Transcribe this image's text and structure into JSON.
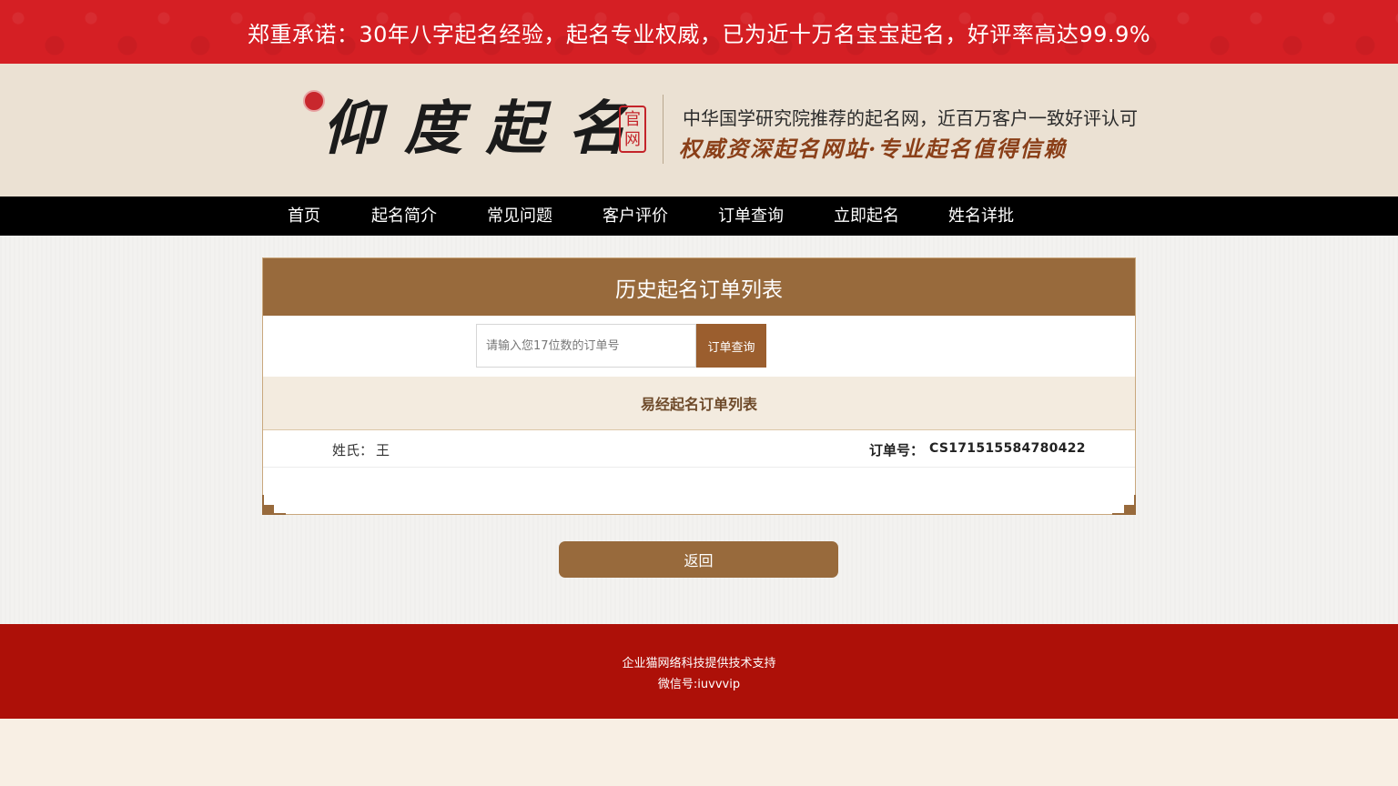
{
  "banner": {
    "text": "郑重承诺：30年八字起名经验，起名专业权威，已为近十万名宝宝起名，好评率高达99.9%"
  },
  "header": {
    "logo_text": "仰度起名",
    "official_stamp": "官网",
    "slogan_line1": "中华国学研究院推荐的起名网，近百万客户一致好评认可",
    "slogan_line2": "权威资深起名网站·专业起名值得信赖"
  },
  "nav": {
    "items": [
      {
        "label": "首页"
      },
      {
        "label": "起名简介"
      },
      {
        "label": "常见问题"
      },
      {
        "label": "客户评价"
      },
      {
        "label": "订单查询"
      },
      {
        "label": "立即起名"
      },
      {
        "label": "姓名详批"
      }
    ]
  },
  "panel": {
    "title": "历史起名订单列表",
    "search_placeholder": "请输入您17位数的订单号",
    "search_value": "",
    "search_button": "订单查询",
    "list_title": "易经起名订单列表",
    "orders": [
      {
        "surname_label": "姓氏：",
        "surname": "王",
        "order_label": "订单号：",
        "order_no": "CS171515584780422"
      }
    ]
  },
  "back_button": "返回",
  "footer": {
    "line1": "企业猫网络科技提供技术支持",
    "line2": "微信号:iuvvvip"
  },
  "colors": {
    "banner_red": "#d51f24",
    "brown_accent": "#986a3c",
    "footer_red": "#ad1008",
    "nav_black": "#000000"
  }
}
